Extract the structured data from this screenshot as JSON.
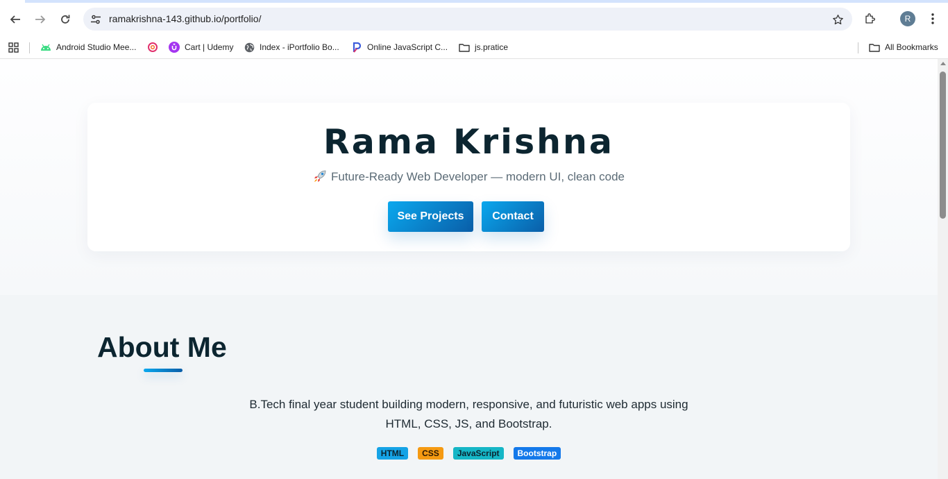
{
  "browser": {
    "url": "ramakrishna-143.github.io/portfolio/",
    "profile_initial": "R",
    "bookmarks": [
      {
        "label": "Android Studio Mee...",
        "icon": "android-icon"
      },
      {
        "label": "",
        "icon": "instagram-like-icon"
      },
      {
        "label": "Cart | Udemy",
        "icon": "udemy-icon"
      },
      {
        "label": "Index - iPortfolio Bo...",
        "icon": "globe-icon"
      },
      {
        "label": "Online JavaScript C...",
        "icon": "programiz-icon"
      },
      {
        "label": "js.pratice",
        "icon": "folder-icon"
      }
    ],
    "all_bookmarks_label": "All Bookmarks"
  },
  "hero": {
    "title": "Rama Krishna",
    "subtitle": "Future-Ready Web Developer — modern UI, clean code",
    "subtitle_icon": "rocket-icon",
    "buttons": {
      "projects": "See Projects",
      "contact": "Contact"
    }
  },
  "about": {
    "title": "About Me",
    "text": "B.Tech final year student building modern, responsive, and futuristic web apps using HTML, CSS, JS, and Bootstrap.",
    "tags": [
      "HTML",
      "CSS",
      "JavaScript",
      "Bootstrap"
    ]
  },
  "colors": {
    "accent_start": "#0aa8ee",
    "accent_end": "#0a5ea8",
    "heading": "#0c2530",
    "tag_html": "#15a3e6",
    "tag_css": "#f59a12",
    "tag_js": "#15b6c6",
    "tag_bootstrap": "#1479ea"
  }
}
